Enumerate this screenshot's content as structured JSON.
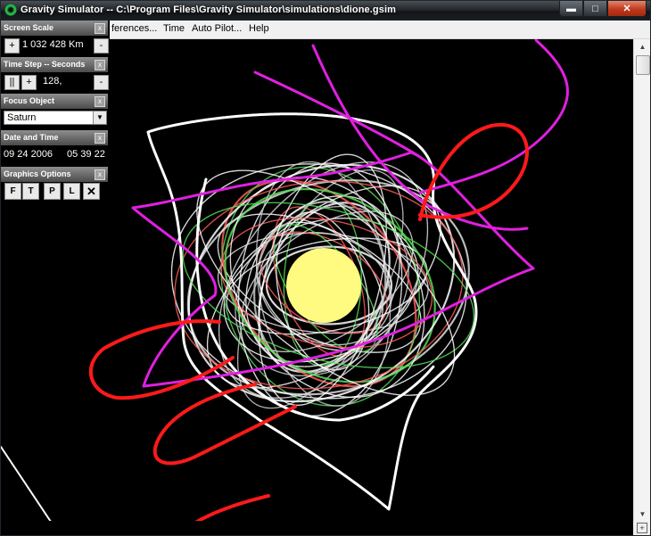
{
  "window": {
    "title": "Gravity Simulator -- C:\\Program Files\\Gravity Simulator\\simulations\\dione.gsim",
    "controls": {
      "minimize": "▬",
      "maximize": "□",
      "close": "✕"
    }
  },
  "menu": [
    "ferences...",
    "Time",
    "Auto Pilot...",
    "Help"
  ],
  "panels": {
    "screen_scale": {
      "title": "Screen Scale",
      "value": "1 032 428  Km",
      "plus": "+",
      "minus": "-"
    },
    "time_step": {
      "title": "Time Step -- Seconds",
      "pause": "||",
      "plus": "+",
      "value": "128,",
      "minus": "-"
    },
    "focus_object": {
      "title": "Focus Object",
      "value": "Saturn"
    },
    "date_time": {
      "title": "Date and Time",
      "date": "09 24 2006",
      "time": "05 39 22"
    },
    "graphics_options": {
      "title": "Graphics Options",
      "buttons": [
        "F",
        "T",
        "P",
        "L"
      ]
    },
    "close_glyph": "x"
  },
  "colors": {
    "background": "#000000",
    "saturn": "#fffb80",
    "orbit_white": "#ffffff",
    "orbit_magenta": "#e020e0",
    "orbit_red": "#ff1a1a",
    "orbit_green": "#33cc33"
  },
  "icons": {
    "app": "gravity-simulator-icon",
    "scroll_up": "scroll-up-arrow-icon",
    "scroll_down": "scroll-down-arrow-icon",
    "zoom_fit": "zoom-fit-icon",
    "resize": "resize-grip-icon"
  }
}
